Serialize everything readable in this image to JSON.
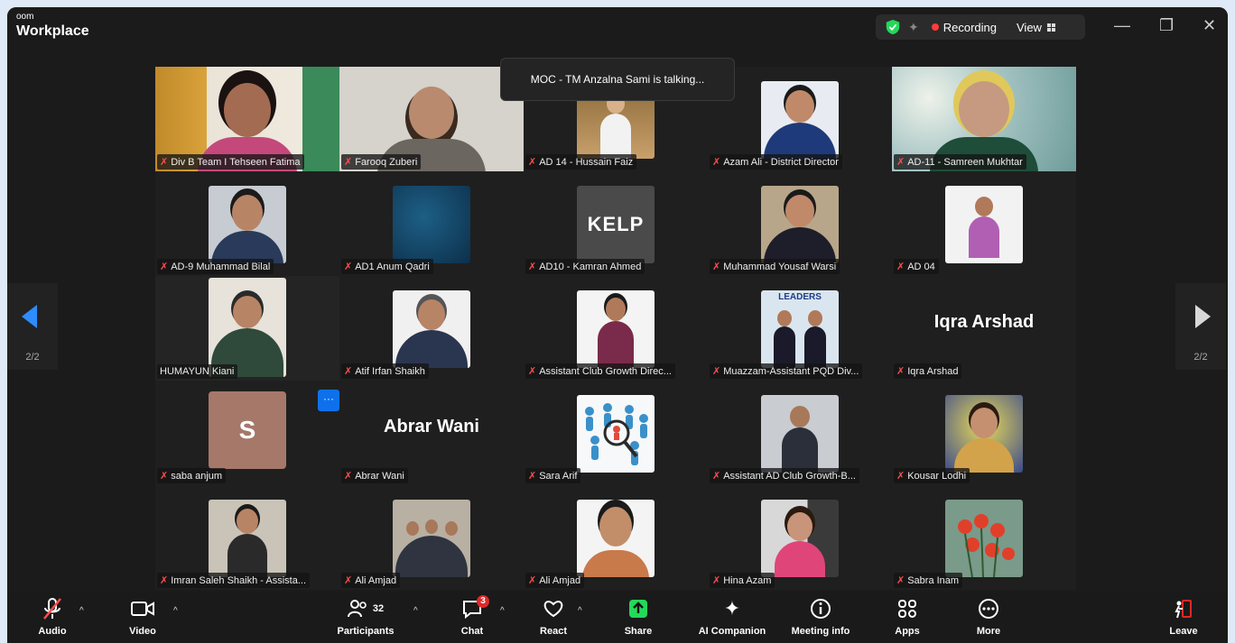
{
  "app": {
    "brand_small": "oom",
    "brand_main": "Workplace"
  },
  "status": {
    "recording": "Recording",
    "view": "View"
  },
  "window_controls": {
    "minimize": "—",
    "restore": "❐",
    "close": "✕"
  },
  "tooltip": "MOC - TM Anzalna Sami is talking...",
  "participants": [
    {
      "name": "Div B Team I Tehseen Fatima",
      "big": ""
    },
    {
      "name": "Farooq Zuberi",
      "big": ""
    },
    {
      "name": "AD 14 - Hussain Faiz",
      "big": ""
    },
    {
      "name": "Azam Ali - District Director",
      "big": ""
    },
    {
      "name": "AD-11 - Samreen Mukhtar",
      "big": ""
    },
    {
      "name": "AD-9 Muhammad Bilal",
      "big": ""
    },
    {
      "name": "AD1 Anum Qadri",
      "big": ""
    },
    {
      "name": "AD10 - Kamran Ahmed",
      "big": ""
    },
    {
      "name": "Muhammad Yousaf Warsi",
      "big": ""
    },
    {
      "name": "AD 04",
      "big": ""
    },
    {
      "name": "HUMAYUN Kiani",
      "big": ""
    },
    {
      "name": "Atif Irfan Shaikh",
      "big": ""
    },
    {
      "name": "Assistant Club Growth Direc...",
      "big": ""
    },
    {
      "name": "Muazzam-Assistant PQD Div...",
      "big": ""
    },
    {
      "name": "Iqra Arshad",
      "big": "Iqra Arshad"
    },
    {
      "name": "saba anjum",
      "big": ""
    },
    {
      "name": "Abrar Wani",
      "big": "Abrar Wani"
    },
    {
      "name": "Sara Arif",
      "big": ""
    },
    {
      "name": "Assistant AD Club Growth-B...",
      "big": ""
    },
    {
      "name": "Kousar Lodhi",
      "big": ""
    },
    {
      "name": "Imran Saleh Shaikh - Assista...",
      "big": ""
    },
    {
      "name": "Ali Amjad",
      "big": ""
    },
    {
      "name": "Ali Amjad",
      "big": ""
    },
    {
      "name": "Hina Azam",
      "big": ""
    },
    {
      "name": "Sabra Inam",
      "big": ""
    }
  ],
  "avatar_letter": "S",
  "kelp_logo": "KELP",
  "leaders_banner": "LEADERS",
  "pager": {
    "left": "2/2",
    "right": "2/2"
  },
  "more_badge": "···",
  "toolbar": {
    "audio": "Audio",
    "video": "Video",
    "participants": "Participants",
    "participants_count": "32",
    "chat": "Chat",
    "chat_badge": "3",
    "react": "React",
    "share": "Share",
    "ai": "AI Companion",
    "meeting_info": "Meeting info",
    "apps": "Apps",
    "more": "More",
    "leave": "Leave"
  },
  "colors": {
    "accent": "#0e71eb",
    "mic_off": "#ff4d4d",
    "share": "#23d959",
    "recording": "#ff3b3b"
  }
}
